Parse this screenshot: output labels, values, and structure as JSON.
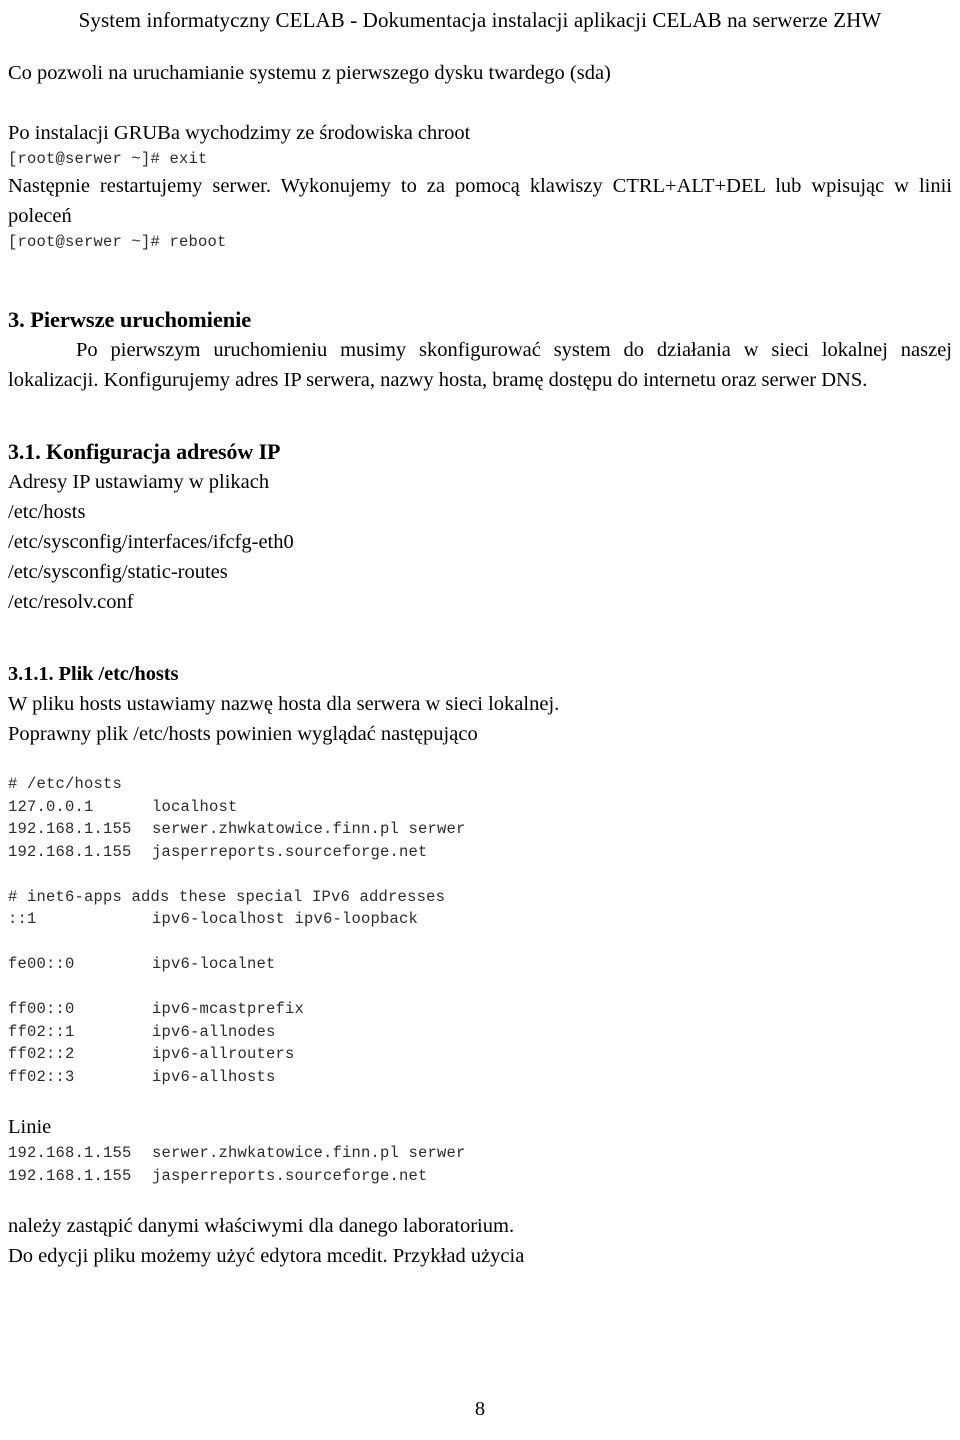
{
  "document": {
    "header": "System informatyczny CELAB - Dokumentacja instalacji aplikacji CELAB na serwerze ZHW",
    "page_number": "8"
  },
  "intro": {
    "line_sda": "Co pozwoli na uruchamianie systemu z pierwszego dysku twardego (sda)",
    "line_chroot": "Po instalacji GRUBa wychodzimy ze środowiska chroot",
    "cmd_exit": "[root@serwer ~]# exit",
    "para_restart": "Następnie restartujemy serwer. Wykonujemy to za pomocą klawiszy CTRL+ALT+DEL lub wpisując w linii poleceń",
    "cmd_reboot": "[root@serwer ~]# reboot"
  },
  "section3": {
    "heading": "3. Pierwsze uruchomienie",
    "para": "Po pierwszym uruchomieniu musimy skonfigurować system do działania w sieci lokalnej naszej lokalizacji. Konfigurujemy adres IP serwera, nazwy hosta, bramę dostępu do internetu oraz serwer DNS."
  },
  "section31": {
    "heading": "3.1. Konfiguracja adresów IP",
    "lead": "Adresy IP ustawiamy w plikach",
    "files": [
      "/etc/hosts",
      "/etc/sysconfig/interfaces/ifcfg-eth0",
      "/etc/sysconfig/static-routes",
      "/etc/resolv.conf"
    ]
  },
  "section311": {
    "heading": "3.1.1. Plik /etc/hosts",
    "para_line1": "W pliku hosts ustawiamy nazwę hosta dla serwera w sieci lokalnej.",
    "para_line2": "Poprawny plik /etc/hosts powinien wyglądać następująco",
    "hosts_file": [
      {
        "type": "comment",
        "text": "# /etc/hosts"
      },
      {
        "type": "entry",
        "address": "127.0.0.1",
        "names": "localhost"
      },
      {
        "type": "entry",
        "address": "192.168.1.155",
        "names": "serwer.zhwkatowice.finn.pl serwer"
      },
      {
        "type": "entry",
        "address": "192.168.1.155",
        "names": "jasperreports.sourceforge.net"
      },
      {
        "type": "blank",
        "text": ""
      },
      {
        "type": "comment",
        "text": "# inet6-apps adds these special IPv6 addresses"
      },
      {
        "type": "entry",
        "address": "::1",
        "names": "ipv6-localhost ipv6-loopback"
      },
      {
        "type": "blank",
        "text": ""
      },
      {
        "type": "entry",
        "address": "fe00::0",
        "names": "ipv6-localnet"
      },
      {
        "type": "blank",
        "text": ""
      },
      {
        "type": "entry",
        "address": "ff00::0",
        "names": "ipv6-mcastprefix"
      },
      {
        "type": "entry",
        "address": "ff02::1",
        "names": "ipv6-allnodes"
      },
      {
        "type": "entry",
        "address": "ff02::2",
        "names": "ipv6-allrouters"
      },
      {
        "type": "entry",
        "address": "ff02::3",
        "names": "ipv6-allhosts"
      }
    ],
    "linie_heading": "Linie",
    "linie_lines": [
      {
        "address": "192.168.1.155",
        "names": "serwer.zhwkatowice.finn.pl serwer"
      },
      {
        "address": "192.168.1.155",
        "names": "jasperreports.sourceforge.net"
      }
    ],
    "closing_line1": "należy zastąpić danymi właściwymi dla danego laboratorium.",
    "closing_line2": "Do edycji pliku możemy użyć edytora mcedit. Przykład użycia"
  }
}
